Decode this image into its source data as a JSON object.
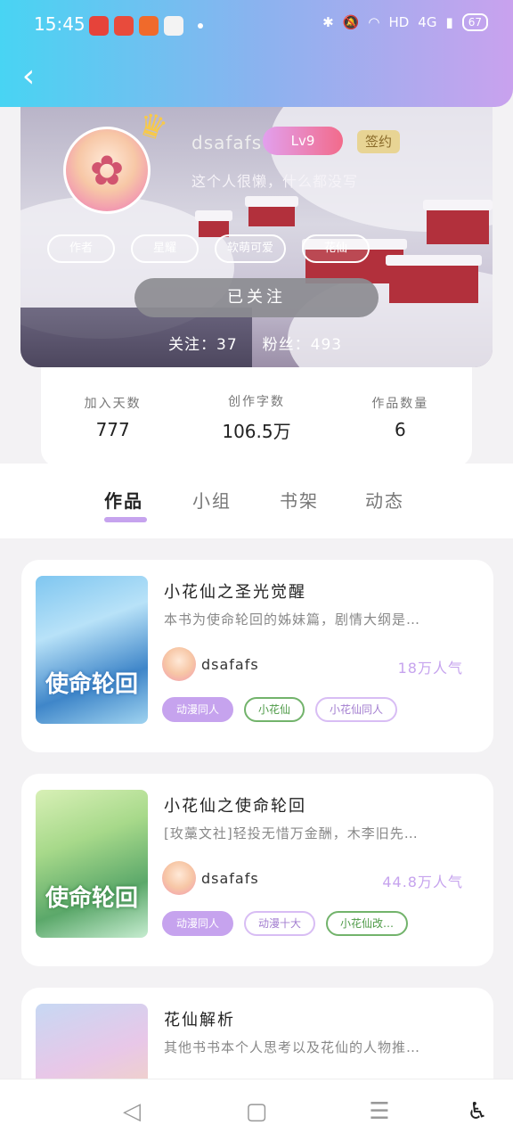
{
  "status": {
    "time": "15:45",
    "network": "HD",
    "signal": "4G",
    "battery": "67"
  },
  "profile": {
    "username": "dsafafs",
    "level": "Lv9",
    "sign_badge": "签约",
    "bio": "这个人很懒，什么都没写",
    "tags": [
      "作者",
      "星耀",
      "软萌可爱",
      "花仙"
    ],
    "follow_button": "已关注",
    "following": "关注：37",
    "fans": "粉丝：493"
  },
  "stats": [
    {
      "label": "加入天数",
      "value": "777"
    },
    {
      "label": "创作字数",
      "value": "106.5万"
    },
    {
      "label": "作品数量",
      "value": "6"
    }
  ],
  "tabs": [
    "作品",
    "小组",
    "书架",
    "动态"
  ],
  "books": [
    {
      "title": "小花仙之圣光觉醒",
      "desc": "本书为使命轮回的姊妹篇，剧情大纲是…",
      "cover_text": "使命轮回",
      "author": "dsafafs",
      "popularity": "18万人气",
      "chips": [
        {
          "label": "动漫同人",
          "style": "filled"
        },
        {
          "label": "小花仙",
          "style": "green"
        },
        {
          "label": "小花仙同人",
          "style": "purple"
        }
      ]
    },
    {
      "title": "小花仙之使命轮回",
      "desc": "[玫藁文社]轻投无惜万金酬，木李旧先…",
      "cover_text": "使命轮回",
      "author": "dsafafs",
      "popularity": "44.8万人气",
      "chips": [
        {
          "label": "动漫同人",
          "style": "filled"
        },
        {
          "label": "动漫十大",
          "style": "purple"
        },
        {
          "label": "小花仙改…",
          "style": "green"
        }
      ]
    },
    {
      "title": "花仙解析",
      "desc": "其他书书本个人思考以及花仙的人物推…",
      "cover_text": "",
      "author": "",
      "popularity": "",
      "chips": []
    }
  ],
  "colors": {
    "accent": "#c6a3ee",
    "header_start": "#48d4f3",
    "header_end": "#c9a2ee",
    "level_gradient_end": "#f26b8b"
  },
  "icons": {
    "back": "back-arrow-icon",
    "nav": [
      "nav-back-icon",
      "nav-home-icon",
      "nav-recents-icon",
      "accessibility-icon"
    ]
  }
}
